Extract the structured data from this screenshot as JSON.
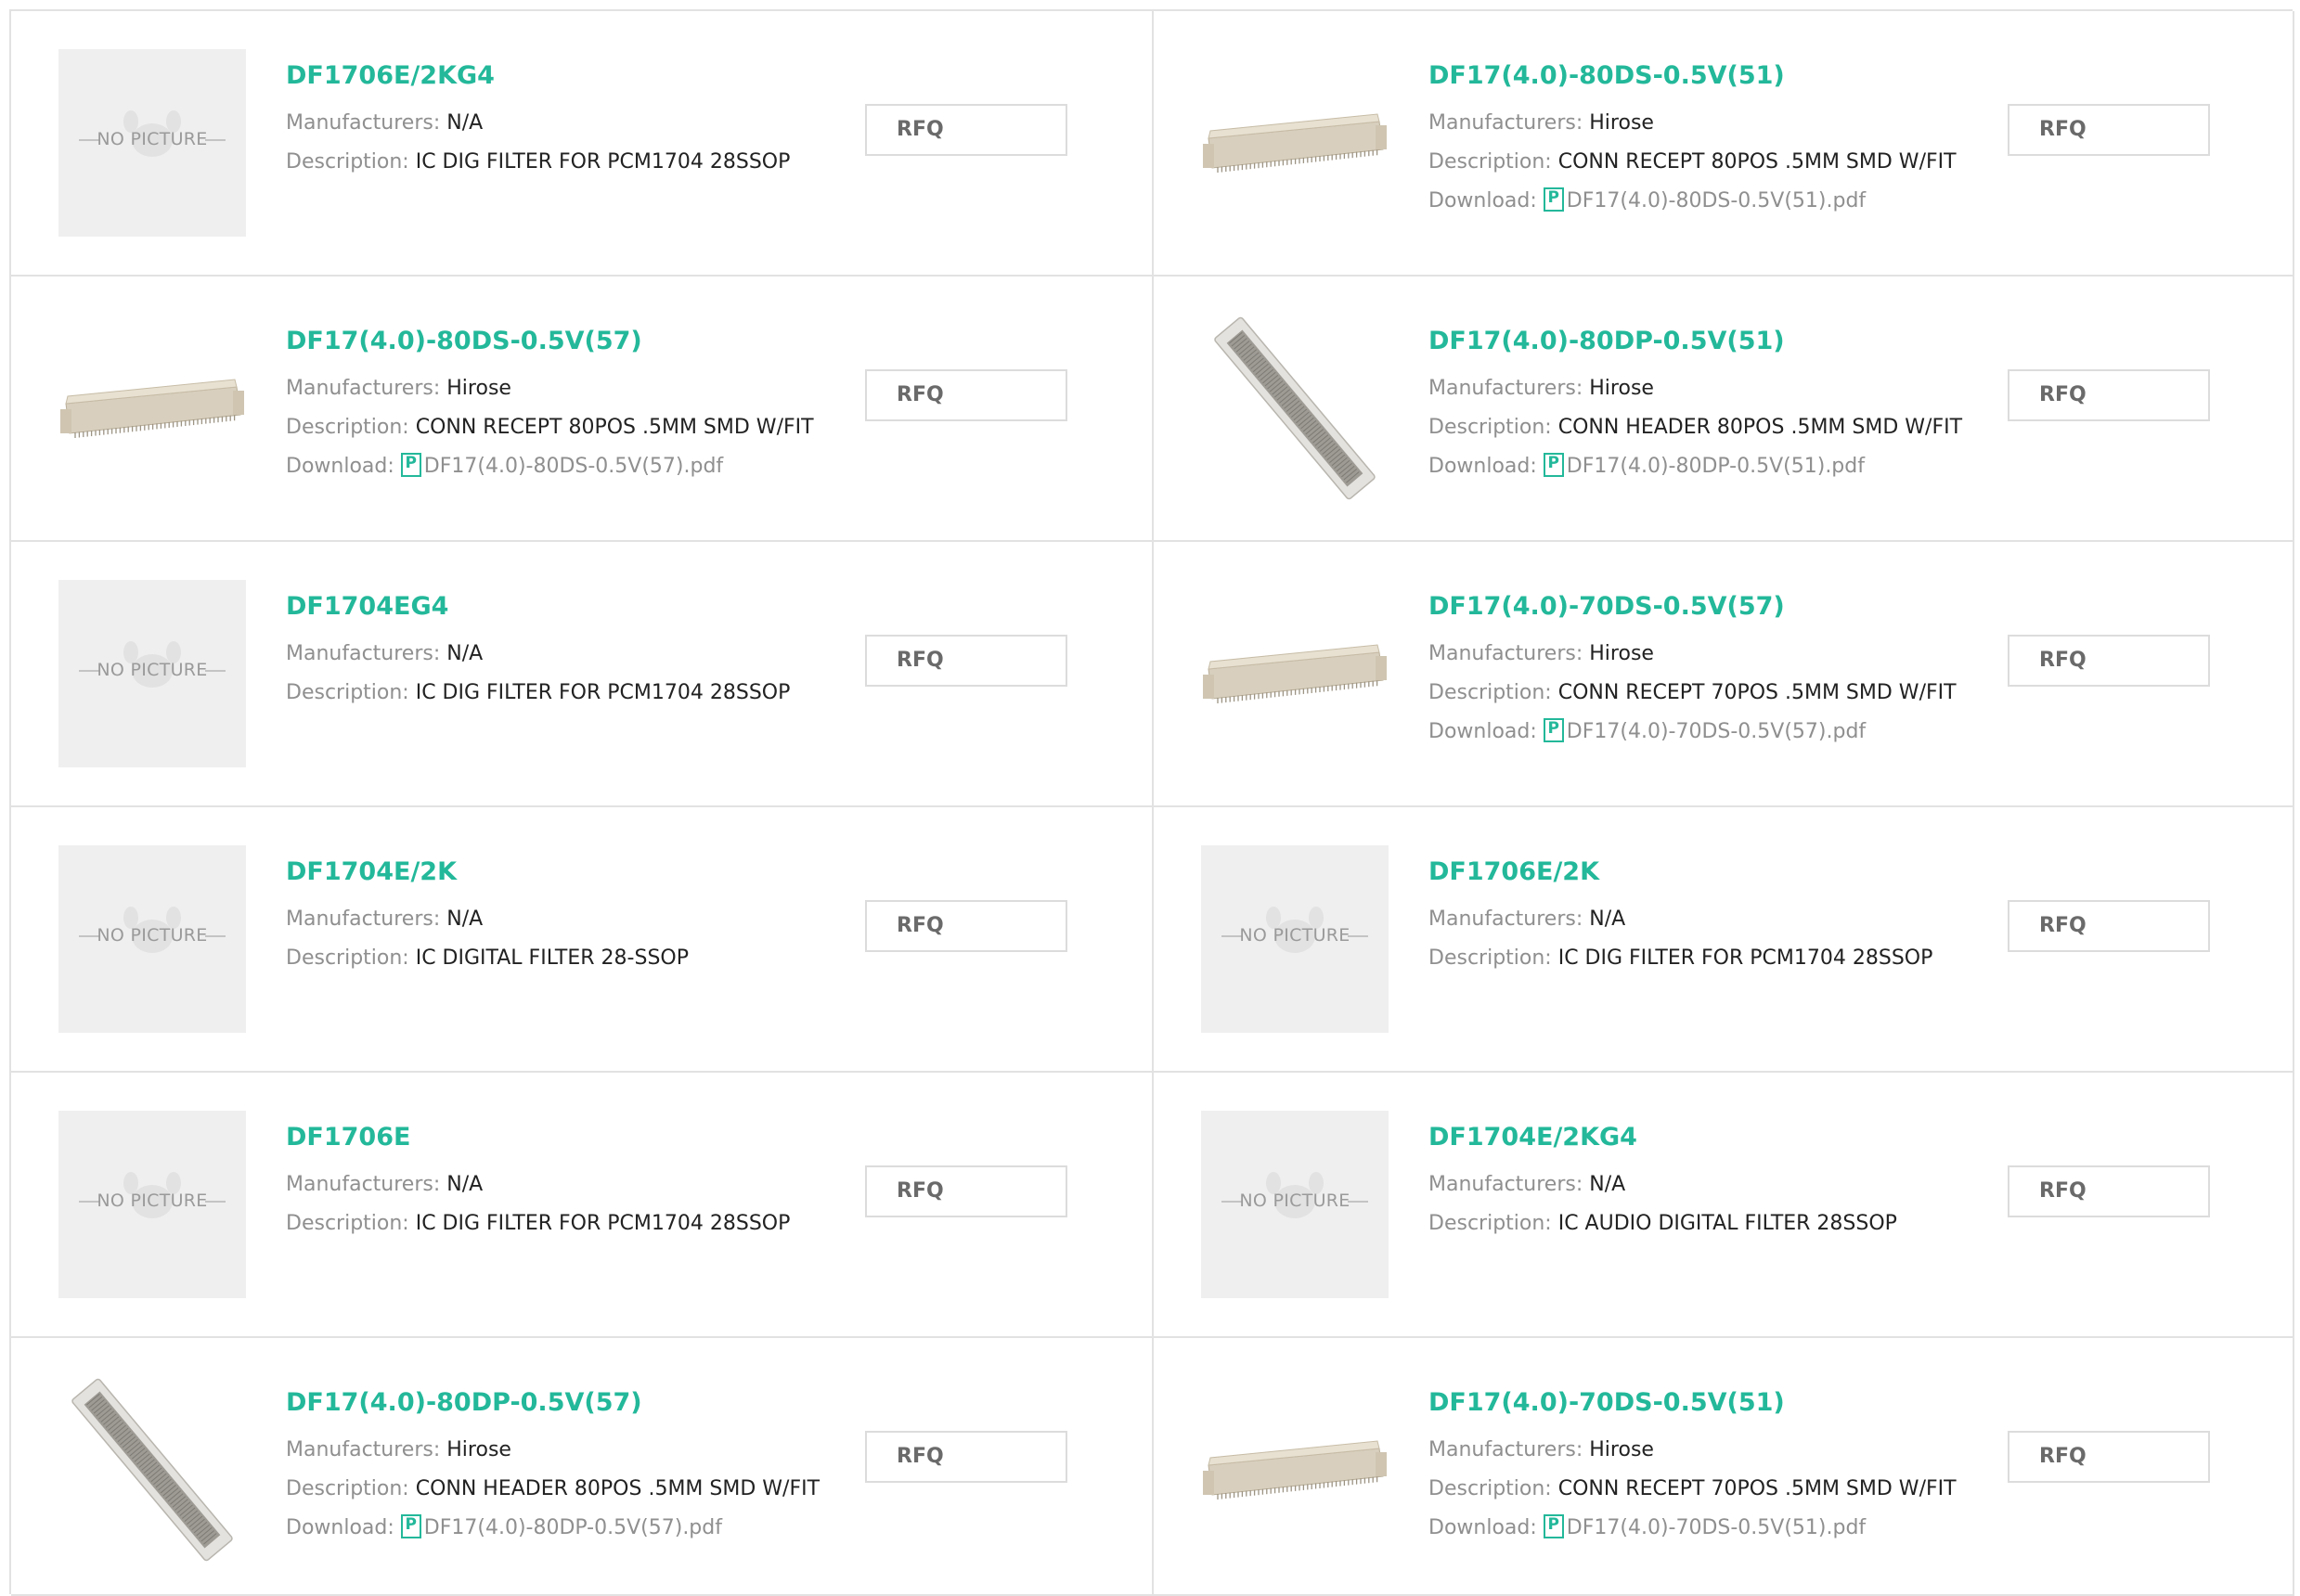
{
  "labels": {
    "manufacturers": "Manufacturers:",
    "description": "Description:",
    "download": "Download:",
    "rfq": "RFQ",
    "no_picture": "NO PICTURE",
    "pdf_glyph": "P"
  },
  "colors": {
    "accent": "#23b89a",
    "label": "#8f8f8f",
    "border": "#e2e2e2"
  },
  "products": [
    {
      "part": "DF1706E/2KG4",
      "manufacturer": "N/A",
      "description": "IC DIG FILTER FOR PCM1704 28SSOP",
      "download": null,
      "image": "no-picture"
    },
    {
      "part": "DF17(4.0)-80DS-0.5V(51)",
      "manufacturer": "Hirose",
      "description": "CONN RECEPT 80POS .5MM SMD W/FIT",
      "download": "DF17(4.0)-80DS-0.5V(51).pdf",
      "image": "receptacle"
    },
    {
      "part": "DF17(4.0)-80DS-0.5V(57)",
      "manufacturer": "Hirose",
      "description": "CONN RECEPT 80POS .5MM SMD W/FIT",
      "download": "DF17(4.0)-80DS-0.5V(57).pdf",
      "image": "receptacle"
    },
    {
      "part": "DF17(4.0)-80DP-0.5V(51)",
      "manufacturer": "Hirose",
      "description": "CONN HEADER 80POS .5MM SMD W/FIT",
      "download": "DF17(4.0)-80DP-0.5V(51).pdf",
      "image": "header"
    },
    {
      "part": "DF1704EG4",
      "manufacturer": "N/A",
      "description": "IC DIG FILTER FOR PCM1704 28SSOP",
      "download": null,
      "image": "no-picture"
    },
    {
      "part": "DF17(4.0)-70DS-0.5V(57)",
      "manufacturer": "Hirose",
      "description": "CONN RECEPT 70POS .5MM SMD W/FIT",
      "download": "DF17(4.0)-70DS-0.5V(57).pdf",
      "image": "receptacle"
    },
    {
      "part": "DF1704E/2K",
      "manufacturer": "N/A",
      "description": "IC DIGITAL FILTER 28-SSOP",
      "download": null,
      "image": "no-picture"
    },
    {
      "part": "DF1706E/2K",
      "manufacturer": "N/A",
      "description": "IC DIG FILTER FOR PCM1704 28SSOP",
      "download": null,
      "image": "no-picture"
    },
    {
      "part": "DF1706E",
      "manufacturer": "N/A",
      "description": "IC DIG FILTER FOR PCM1704 28SSOP",
      "download": null,
      "image": "no-picture"
    },
    {
      "part": "DF1704E/2KG4",
      "manufacturer": "N/A",
      "description": "IC AUDIO DIGITAL FILTER 28SSOP",
      "download": null,
      "image": "no-picture"
    },
    {
      "part": "DF17(4.0)-80DP-0.5V(57)",
      "manufacturer": "Hirose",
      "description": "CONN HEADER 80POS .5MM SMD W/FIT",
      "download": "DF17(4.0)-80DP-0.5V(57).pdf",
      "image": "header"
    },
    {
      "part": "DF17(4.0)-70DS-0.5V(51)",
      "manufacturer": "Hirose",
      "description": "CONN RECEPT 70POS .5MM SMD W/FIT",
      "download": "DF17(4.0)-70DS-0.5V(51).pdf",
      "image": "receptacle"
    }
  ]
}
